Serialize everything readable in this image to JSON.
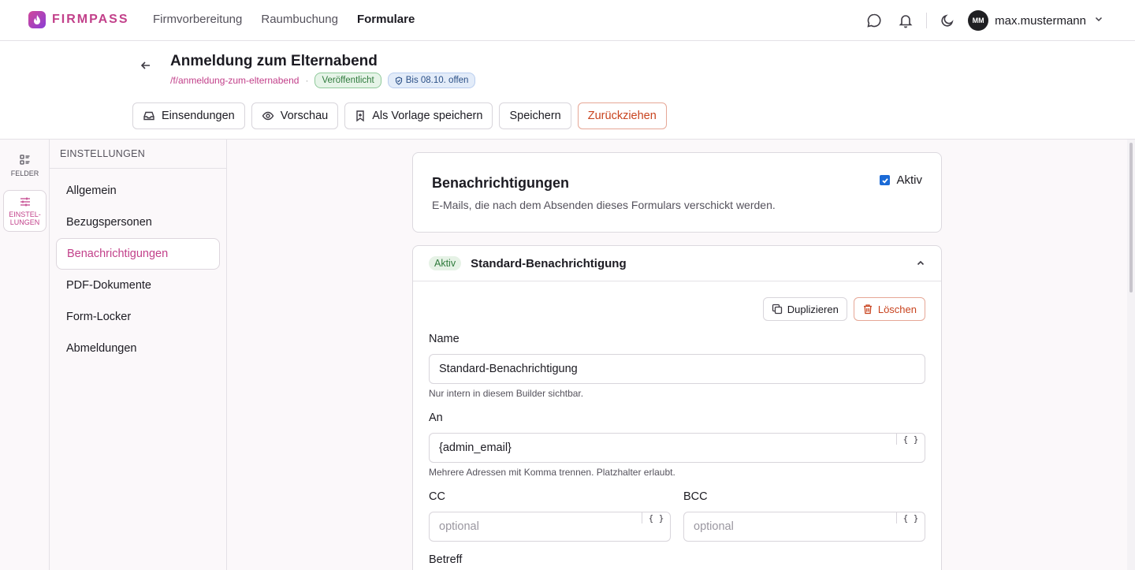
{
  "brand": {
    "name": "FIRMPASS"
  },
  "nav": {
    "links": [
      "Firmvorbereitung",
      "Raumbuchung",
      "Formulare"
    ],
    "active": "Formulare"
  },
  "user": {
    "initials": "MM",
    "name": "max.mustermann"
  },
  "header": {
    "title": "Anmeldung zum Elternabend",
    "slug": "/f/anmeldung-zum-elternabend",
    "status_badge": "Veröffentlicht",
    "deadline_badge": "Bis 08.10. offen",
    "actions": {
      "submissions": "Einsendungen",
      "preview": "Vorschau",
      "save_template": "Als Vorlage speichern",
      "save": "Speichern",
      "withdraw": "Zurückziehen"
    }
  },
  "rail": {
    "fields": "FELDER",
    "settings_line1": "EINSTEL-",
    "settings_line2": "LUNGEN"
  },
  "settings": {
    "title": "EINSTELLUNGEN",
    "items": [
      "Allgemein",
      "Bezugspersonen",
      "Benachrichtigungen",
      "PDF-Dokumente",
      "Form-Locker",
      "Abmeldungen"
    ],
    "active": "Benachrichtigungen"
  },
  "notifications_card": {
    "title": "Benachrichtigungen",
    "description": "E-Mails, die nach dem Absenden dieses Formulars verschickt werden.",
    "active_label": "Aktiv",
    "active": true
  },
  "notification": {
    "status": "Aktiv",
    "name": "Standard-Benachrichtigung",
    "duplicate_label": "Duplizieren",
    "delete_label": "Löschen",
    "name_label": "Name",
    "name_value": "Standard-Benachrichtigung",
    "name_help": "Nur intern in diesem Builder sichtbar.",
    "to_label": "An",
    "to_value": "{admin_email}",
    "to_help": "Mehrere Adressen mit Komma trennen. Platzhalter erlaubt.",
    "cc_label": "CC",
    "cc_placeholder": "optional",
    "bcc_label": "BCC",
    "bcc_placeholder": "optional",
    "subject_label": "Betreff",
    "placeholder_icon": "{ }"
  },
  "colors": {
    "accent": "#c2408a",
    "danger": "#c8431e",
    "checkbox": "#1b6ad6"
  }
}
